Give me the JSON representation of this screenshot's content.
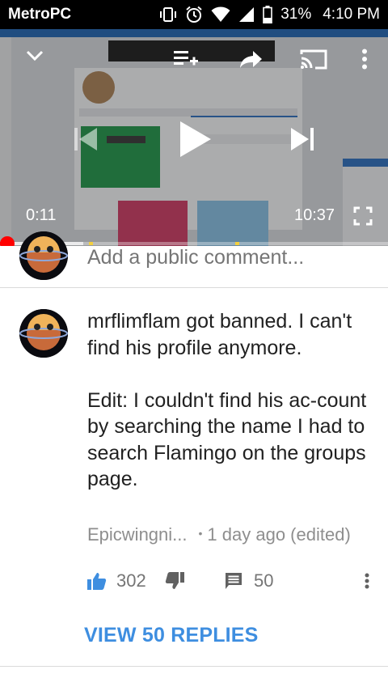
{
  "status_bar": {
    "carrier": "MetroPCS",
    "battery": "31%",
    "time": "4:10 PM"
  },
  "player": {
    "current_time": "0:11",
    "duration": "10:37",
    "progress_fraction": 0.017,
    "buffer_fraction": 0.215,
    "icons": [
      "chevron-down-icon",
      "add-to-queue-icon",
      "share-icon",
      "cast-icon",
      "more-vert-icon",
      "skip-previous-icon",
      "play-icon",
      "skip-next-icon",
      "fullscreen-icon"
    ]
  },
  "add_comment": {
    "placeholder": "Add a public comment..."
  },
  "comment": {
    "paragraph1": "mrflimflam got banned. I can't find his profile anymore.",
    "paragraph2": "Edit: I couldn't find his ac-count by searching the name I had to search Flamingo on the groups page.",
    "author": "Epicwingni...",
    "separator": "•",
    "time_ago": "1 day ago (edited)",
    "like_count": "302",
    "reply_count": "50"
  },
  "replies": {
    "label": "VIEW 50 REPLIES"
  },
  "colors": {
    "accent_blue": "#3e8ee0",
    "progress_red": "#ff0000",
    "secondary_text": "#8e8e8e"
  }
}
